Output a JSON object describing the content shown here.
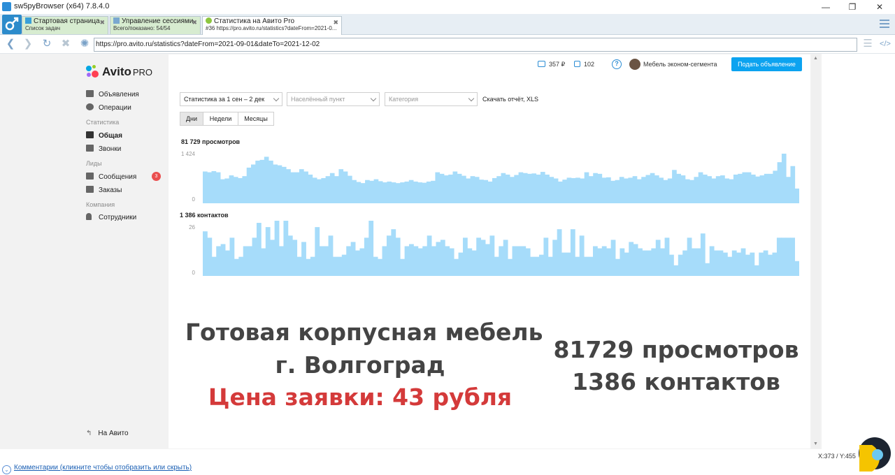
{
  "window": {
    "title": "sw5pyBrowser (x64) 7.8.4.0"
  },
  "tabs": [
    {
      "title": "Стартовая страница",
      "subtitle": "Список задач"
    },
    {
      "title": "Управление сессиями",
      "subtitle": "Всего/показано: 54/54"
    },
    {
      "title": "Статистика на Авито Pro",
      "subtitle": "#36 https://pro.avito.ru/statistics?dateFrom=2021-0..."
    }
  ],
  "address_bar": {
    "url": "https://pro.avito.ru/statistics?dateFrom=2021-09-01&dateTo=2021-12-02"
  },
  "logo": {
    "name": "Avito",
    "suffix": "PRO"
  },
  "sidebar": {
    "items": [
      {
        "label": "Объявления",
        "icon": "listings-icon"
      },
      {
        "label": "Операции",
        "icon": "operations-icon"
      },
      {
        "label": "Общая",
        "icon": "bar-chart-icon",
        "active": true
      },
      {
        "label": "Звонки",
        "icon": "phone-icon"
      },
      {
        "label": "Сообщения",
        "icon": "message-icon",
        "badge": "3"
      },
      {
        "label": "Заказы",
        "icon": "orders-icon"
      },
      {
        "label": "Сотрудники",
        "icon": "person-icon"
      }
    ],
    "headers": {
      "stats": "Статистика",
      "leads": "Лиды",
      "company": "Компания"
    },
    "back_link": "На Авито"
  },
  "header": {
    "balance": "357 ₽",
    "bonus": "102",
    "user_name": "Мебель эконом-сегмента",
    "post_button": "Подать объявление"
  },
  "filters": {
    "period": "Статистика за 1 сен – 2 дек",
    "city_placeholder": "Населённый пункт",
    "category_placeholder": "Категория",
    "download": "Скачать отчёт, XLS"
  },
  "granularity": {
    "options": [
      "Дни",
      "Недели",
      "Месяцы"
    ],
    "selected": "Дни"
  },
  "chart_data": [
    {
      "type": "bar",
      "title": "81 729 просмотров",
      "y_ticks": [
        "1 424",
        "0"
      ],
      "ylim": [
        0,
        1424
      ],
      "color": "#a6dcfa",
      "values": [
        820,
        800,
        830,
        800,
        620,
        640,
        720,
        680,
        650,
        700,
        920,
        1000,
        1100,
        1120,
        1200,
        1100,
        1000,
        980,
        940,
        880,
        800,
        800,
        880,
        820,
        740,
        660,
        620,
        650,
        700,
        780,
        700,
        880,
        820,
        710,
        600,
        550,
        520,
        600,
        580,
        620,
        570,
        540,
        560,
        540,
        520,
        540,
        560,
        600,
        560,
        540,
        530,
        560,
        580,
        800,
        760,
        720,
        740,
        820,
        760,
        710,
        640,
        700,
        680,
        610,
        600,
        560,
        650,
        700,
        780,
        740,
        680,
        730,
        800,
        780,
        760,
        770,
        740,
        810,
        740,
        680,
        640,
        560,
        610,
        660,
        650,
        660,
        640,
        800,
        700,
        780,
        760,
        660,
        670,
        580,
        600,
        680,
        640,
        660,
        700,
        620,
        680,
        730,
        780,
        720,
        660,
        600,
        640,
        860,
        760,
        720,
        620,
        600,
        680,
        800,
        740,
        700,
        640,
        700,
        720,
        640,
        620,
        740,
        760,
        800,
        800,
        740,
        690,
        720,
        760,
        760,
        840,
        1060,
        1280,
        680,
        960,
        380
      ]
    },
    {
      "type": "bar",
      "title": "1 386 контактов",
      "y_ticks": [
        "26",
        "0"
      ],
      "ylim": [
        0,
        26
      ],
      "color": "#a6dcfa",
      "values": [
        21,
        18,
        9,
        14,
        15,
        12,
        18,
        8,
        9,
        14,
        14,
        18,
        25,
        13,
        23,
        17,
        26,
        14,
        26,
        19,
        17,
        9,
        16,
        8,
        9,
        23,
        14,
        14,
        19,
        9,
        9,
        10,
        14,
        16,
        12,
        13,
        18,
        28,
        9,
        8,
        14,
        19,
        22,
        18,
        8,
        14,
        15,
        14,
        13,
        14,
        19,
        14,
        16,
        17,
        14,
        13,
        8,
        11,
        18,
        13,
        12,
        18,
        17,
        15,
        19,
        9,
        14,
        17,
        8,
        14,
        14,
        14,
        13,
        9,
        9,
        10,
        18,
        9,
        17,
        22,
        11,
        11,
        22,
        9,
        19,
        9,
        9,
        14,
        13,
        14,
        13,
        17,
        8,
        13,
        11,
        16,
        15,
        13,
        12,
        12,
        13,
        17,
        13,
        18,
        10,
        5,
        10,
        12,
        18,
        13,
        13,
        20,
        6,
        14,
        12,
        12,
        11,
        9,
        12,
        11,
        13,
        10,
        11,
        5,
        11,
        12,
        10,
        11,
        18,
        18,
        18,
        18,
        7
      ]
    }
  ],
  "promo": {
    "line1": "Готовая корпусная мебель",
    "line2": "г. Волгоград",
    "line3": "Цена заявки: 43 рубля",
    "stat1": "81729 просмотров",
    "stat2": "1386 контактов"
  },
  "statusbar": {
    "comments": "Комментарии (кликните чтобы отобразить или скрыть)",
    "coords": "X:373 / Y:455"
  },
  "colors": {
    "accent": "#0ca3f0",
    "bar": "#a6dcfa",
    "promo_red": "#d43a3a",
    "promo_gray": "#444444"
  }
}
